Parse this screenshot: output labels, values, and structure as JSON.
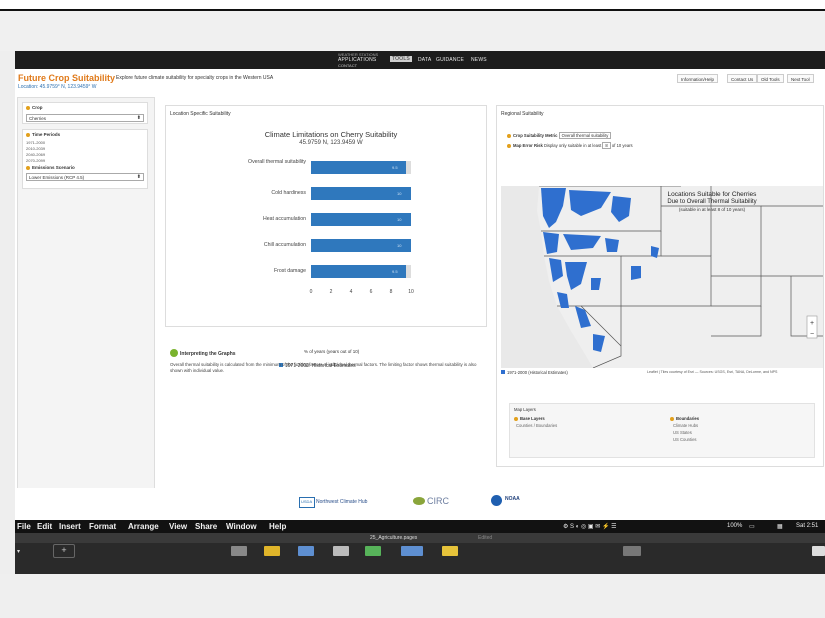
{
  "nav": {
    "top": "WEATHER STATIONS",
    "items": [
      "APPLICATIONS",
      "TOOLS",
      "DATA",
      "GUIDANCE",
      "NEWS"
    ],
    "selected": "TOOLS",
    "contact": "CONTACT"
  },
  "header": {
    "title": "Future Crop Suitability",
    "subtitle": "Explore future climate suitability for specialty crops in the Western USA",
    "location": "Location: 45.9759° N, 123.9459° W",
    "buttons": [
      "Information/Help",
      "Contact Us",
      "Old Tools",
      "Next Tool"
    ]
  },
  "left": {
    "crop_label": "Crop",
    "crop_value": "Cherries",
    "time_label": "Time Periods",
    "periods": [
      "1971-2000",
      "2010-2039",
      "2040-2069",
      "2070-2099"
    ],
    "scenario_label": "Emissions Scenario",
    "scenario_value": "Lower Emissions (RCP 4.5)"
  },
  "middle": {
    "panel_title": "Location Specific Suitability",
    "chart_data": {
      "type": "bar",
      "title": "Climate Limitations on Cherry Suitability",
      "subtitle": "45.9759 N, 123.9459 W",
      "categories": [
        "Overall thermal suitability",
        "Cold hardiness",
        "Heat accumulation",
        "Chill accumulation",
        "Frost damage"
      ],
      "series": [
        {
          "name": "1971-2000: Historical Estimates",
          "values": [
            9.5,
            10,
            10,
            10,
            9.5
          ]
        }
      ],
      "xlabel": "% of years (years out of 10)",
      "xticks": [
        "0",
        "2",
        "4",
        "6",
        "8",
        "10"
      ],
      "xlim": [
        0,
        10
      ],
      "bar_labels": [
        "9.5",
        "10",
        "10",
        "10",
        "9.5"
      ],
      "colors": {
        "bar": "#2f78bd",
        "background": "#dddddd"
      }
    },
    "interp_title": "Interpreting the Graphs",
    "interp_text": "Overall thermal suitability is calculated from the minimum of the limiting factors of individual thermal factors. The limiting factor shows thermal suitability is also shown with individual value."
  },
  "right": {
    "panel_title": "Regional Suitability",
    "metric_label": "Crop Suitability Metric",
    "metric_value": "Overall thermal suitability",
    "years_label": "Map Error Risk",
    "years_text": "Display only suitable in at least",
    "years_value": "8",
    "years_suffix": "of 10 years",
    "map_title": "Locations Suitable for Cherries",
    "map_title2": "Due to Overall Thermal Suitability",
    "map_title3": "(suitable in at least 8 of 10 years)",
    "legend": "1971-2000 (Historical Estimates)",
    "credit": "Leaflet | Tiles courtesy of Esri — Sources: USGS, Esri, TANA, DeLorme, and NPS",
    "layers_label": "Map Layers",
    "base_label": "Base Layers",
    "base_items": [
      "Counties / Boundaries"
    ],
    "overlay_label": "Boundaries",
    "overlay_items": [
      "Climate Hubs",
      "US States",
      "US Counties"
    ]
  },
  "footer": {
    "logo1": "USDA",
    "logo1_text": "Northwest Climate Hub",
    "logo2": "CIRC",
    "logo3": "NOAA"
  },
  "mac": {
    "menus": [
      "File",
      "Edit",
      "Insert",
      "Format",
      "Arrange",
      "View",
      "Share",
      "Window",
      "Help"
    ],
    "doc_name": "25_Agriculture.pages",
    "doc_status": "Edited",
    "battery": "100%",
    "clock": "Sat 2:51"
  }
}
